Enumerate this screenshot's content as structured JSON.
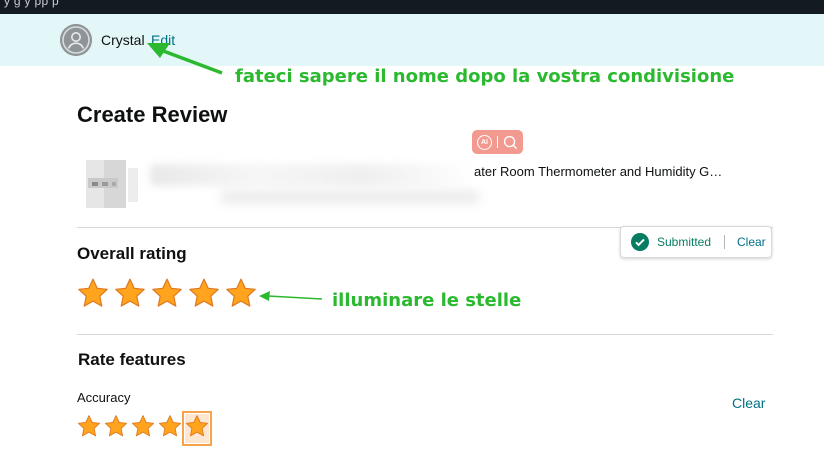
{
  "top_strip": {
    "text": "y g                                          y                      pp                                                                          p       "
  },
  "user": {
    "name": "Crystal",
    "edit_label": "Edit"
  },
  "annotations": {
    "top_note": "fateci sapere il nome dopo la vostra condivisione",
    "stars_note": "illuminare le stelle",
    "color": "#2bb92f"
  },
  "page": {
    "title": "Create Review"
  },
  "product": {
    "title_partial": "ater Room Thermometer and Humidity G…"
  },
  "ai_badge": {
    "label": "AI"
  },
  "overall": {
    "title": "Overall rating",
    "rating": 5,
    "max": 5,
    "status": "Submitted",
    "clear_label": "Clear"
  },
  "features": {
    "title": "Rate features",
    "items": [
      {
        "label": "Accuracy",
        "rating": 5,
        "max": 5,
        "clear_label": "Clear"
      }
    ]
  },
  "colors": {
    "star_fill": "#ffa41c",
    "link": "#007185",
    "success": "#067d62",
    "user_bar_bg": "#e3f6f8"
  },
  "icons": [
    "user-avatar-icon",
    "ai-icon",
    "search-icon",
    "check-circle-icon",
    "star-icon"
  ]
}
